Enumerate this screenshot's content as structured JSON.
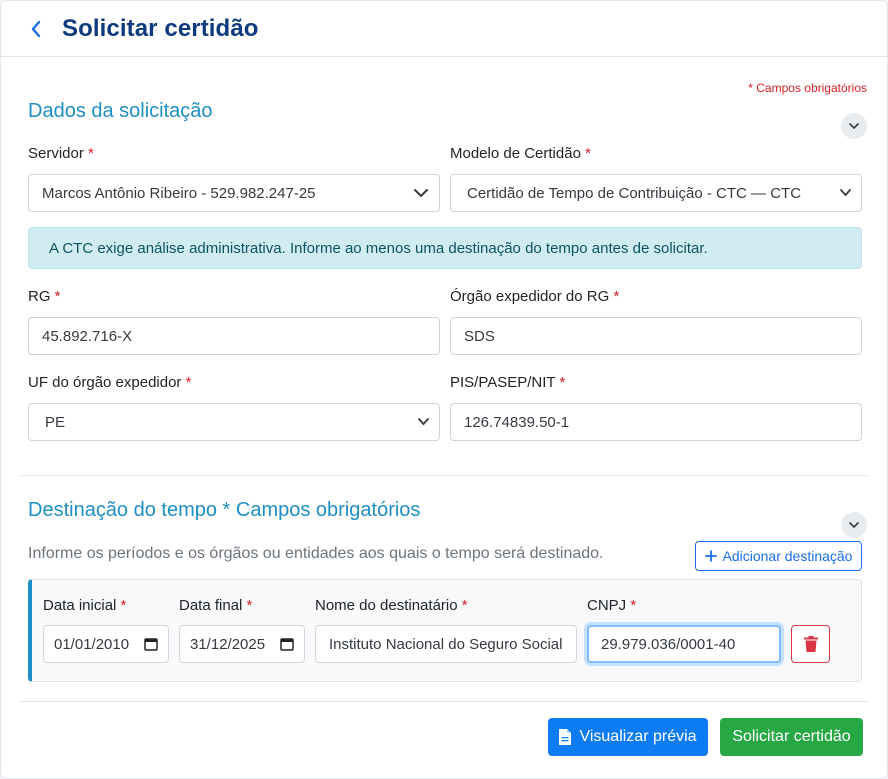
{
  "header": {
    "title": "Solicitar certidão"
  },
  "required_note": "* Campos obrigatórios",
  "section1": {
    "title": "Dados da solicitação",
    "servidor": {
      "label": "Servidor",
      "value": "Marcos Antônio Ribeiro - 529.982.247-25"
    },
    "modelo": {
      "label": "Modelo de Certidão",
      "value": "Certidão de Tempo de Contribuição - CTC — CTC"
    },
    "alert": "A CTC exige análise administrativa. Informe ao menos uma destinação do tempo antes de solicitar.",
    "rg": {
      "label": "RG",
      "value": "45.892.716-X"
    },
    "orgao": {
      "label": "Órgão expedidor do RG",
      "value": "SDS"
    },
    "uf": {
      "label": "UF do órgão expedidor",
      "value": "PE"
    },
    "pis": {
      "label": "PIS/PASEP/NIT",
      "value": "126.74839.50-1"
    }
  },
  "section2": {
    "title": "Destinação do tempo * Campos obrigatórios",
    "description": "Informe os períodos e os órgãos ou entidades aos quais o tempo será destinado.",
    "add_label": "Adicionar destinação",
    "period": {
      "data_inicial": {
        "label": "Data inicial",
        "value": "01/01/2010"
      },
      "data_final": {
        "label": "Data final",
        "value": "31/12/2025"
      },
      "destinatario": {
        "label": "Nome do destinatário",
        "value": "Instituto Nacional do Seguro Social"
      },
      "cnpj": {
        "label": "CNPJ",
        "value": "29.979.036/0001-40"
      }
    }
  },
  "actions": {
    "preview_label": "Visualizar prévia",
    "submit_label": "Solicitar certidão"
  },
  "required_mark": "*",
  "colors": {
    "primary": "#0d7cf2",
    "success": "#28a745",
    "title": "#0b3a7e",
    "section": "#1e8fc4",
    "danger": "#dc3545"
  }
}
